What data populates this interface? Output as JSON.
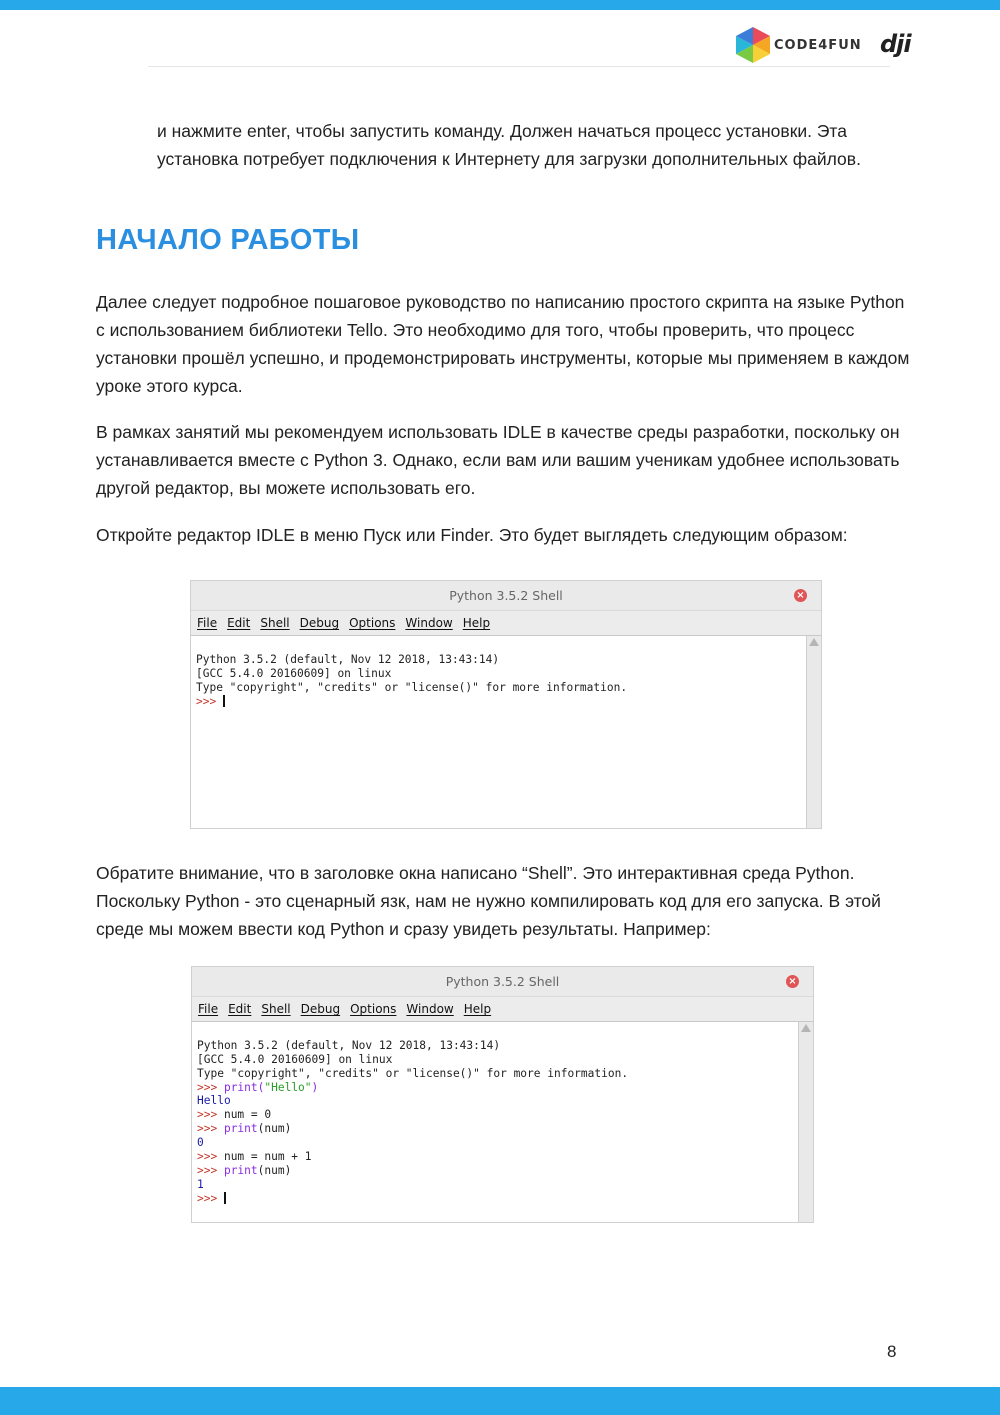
{
  "header": {
    "brand_text": "CODE4FUN",
    "partner_logo_text": "dji",
    "accent_color": "#27a8e8"
  },
  "intro_paragraph": "и нажмите enter, чтобы запустить команду. Должен начаться процесс установки. Эта установка потребует подключения к Интернету для загрузки дополнительных файлов.",
  "section_title": "НАЧАЛО РАБОТЫ",
  "paragraphs": [
    "Далее следует подробное пошаговое руководство по написанию простого скрипта на языке Python с использованием библиотеки Tello. Это необходимо для того, чтобы проверить, что процесс установки прошёл успешно, и продемонстрировать инструменты, которые мы применяем в каждом уроке этого курса.",
    "В рамках занятий мы рекомендуем использовать IDLE в качестве среды разработки, поскольку он устанавливается вместе с Python 3. Однако, если вам или вашим ученикам удобнее использовать другой редактор, вы можете использовать его.",
    "Откройте редактор IDLE в меню Пуск или Finder. Это будет выглядеть следующим образом:",
    "Обратите внимание, что в заголовке окна написано “Shell”. Это интерактивная среда Python. Поскольку Python - это сценарный язк, нам не нужно компилировать код для его запуска. В этой среде мы можем ввести код Python и сразу увидеть результаты. Например:"
  ],
  "shell1": {
    "title": "Python 3.5.2 Shell",
    "menu": [
      "File",
      "Edit",
      "Shell",
      "Debug",
      "Options",
      "Window",
      "Help"
    ],
    "lines": [
      "Python 3.5.2 (default, Nov 12 2018, 13:43:14)",
      "[GCC 5.4.0 20160609] on linux",
      "Type \"copyright\", \"credits\" or \"license()\" for more information."
    ],
    "prompt": ">>> "
  },
  "shell2": {
    "title": "Python 3.5.2 Shell",
    "menu": [
      "File",
      "Edit",
      "Shell",
      "Debug",
      "Options",
      "Window",
      "Help"
    ],
    "lines": [
      "Python 3.5.2 (default, Nov 12 2018, 13:43:14)",
      "[GCC 5.4.0 20160609] on linux",
      "Type \"copyright\", \"credits\" or \"license()\" for more information."
    ],
    "session": {
      "l1_prompt": ">>> ",
      "l1_kw": "print(",
      "l1_str": "\"Hello\"",
      "l1_end": ")",
      "l2_out": "Hello",
      "l3_prompt": ">>> ",
      "l3_code": "num = 0",
      "l4_prompt": ">>> ",
      "l4_kw": "print",
      "l4_end": "(num)",
      "l5_out": "0",
      "l6_prompt": ">>> ",
      "l6_code": "num = num + 1",
      "l7_prompt": ">>> ",
      "l7_kw": "print",
      "l7_end": "(num)",
      "l8_out": "1",
      "l9_prompt": ">>> "
    }
  },
  "page_number": "8"
}
